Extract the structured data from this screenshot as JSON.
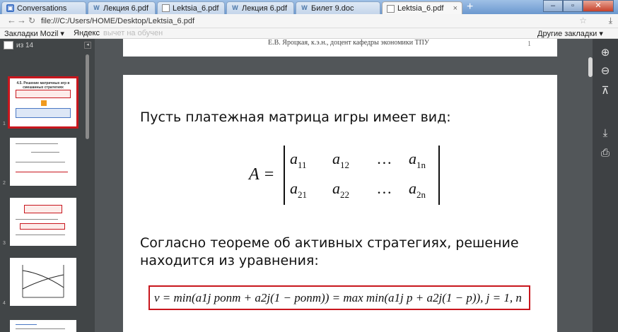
{
  "tabs": [
    {
      "label": "Conversations",
      "icon": "messages-icon"
    },
    {
      "label": "Лекция 6.pdf",
      "icon": "vk-icon"
    },
    {
      "label": "Lektsia_6.pdf",
      "icon": "document-icon"
    },
    {
      "label": "Лекция 6.pdf",
      "icon": "vk-icon"
    },
    {
      "label": "Билет 9.doc",
      "icon": "vk-icon"
    },
    {
      "label": "Lektsia_6.pdf",
      "icon": "document-icon",
      "active": true
    }
  ],
  "address_bar": {
    "url": "file:///C:/Users/HOME/Desktop/Lektsia_6.pdf"
  },
  "bookmarks": {
    "items": [
      "Закладки Mozil",
      "Яндекс",
      "вычет на обучен"
    ],
    "other": "Другие закладки"
  },
  "viewer": {
    "page_total": "из 14",
    "thumb_numbers": [
      "1",
      "2",
      "3",
      "4"
    ],
    "prev_page_footer": "Е.В. Яроцкая, к.э.н., доцент кафедры экономики ТПУ",
    "prev_page_number": "1",
    "thumb1_title": "4.5. Решение матричных игр в смешанных стратегиях"
  },
  "slide": {
    "intro": "Пусть платежная матрица игры имеет вид:",
    "matrix_label": "A =",
    "row1": [
      "a",
      "11",
      "a",
      "12",
      "…",
      "a",
      "1n"
    ],
    "row2": [
      "a",
      "21",
      "a",
      "22",
      "…",
      "a",
      "2n"
    ],
    "theorem_text": "Согласно теореме об активных стратегиях, решение находится из уравнения:",
    "formula": "v = min(a1j pопт + a2j(1 − pопт)) = max min(a1j p + a2j(1 − p)), j = 1, n"
  },
  "colors": {
    "accent_red": "#c8161d",
    "viewer_bg": "#525659"
  }
}
